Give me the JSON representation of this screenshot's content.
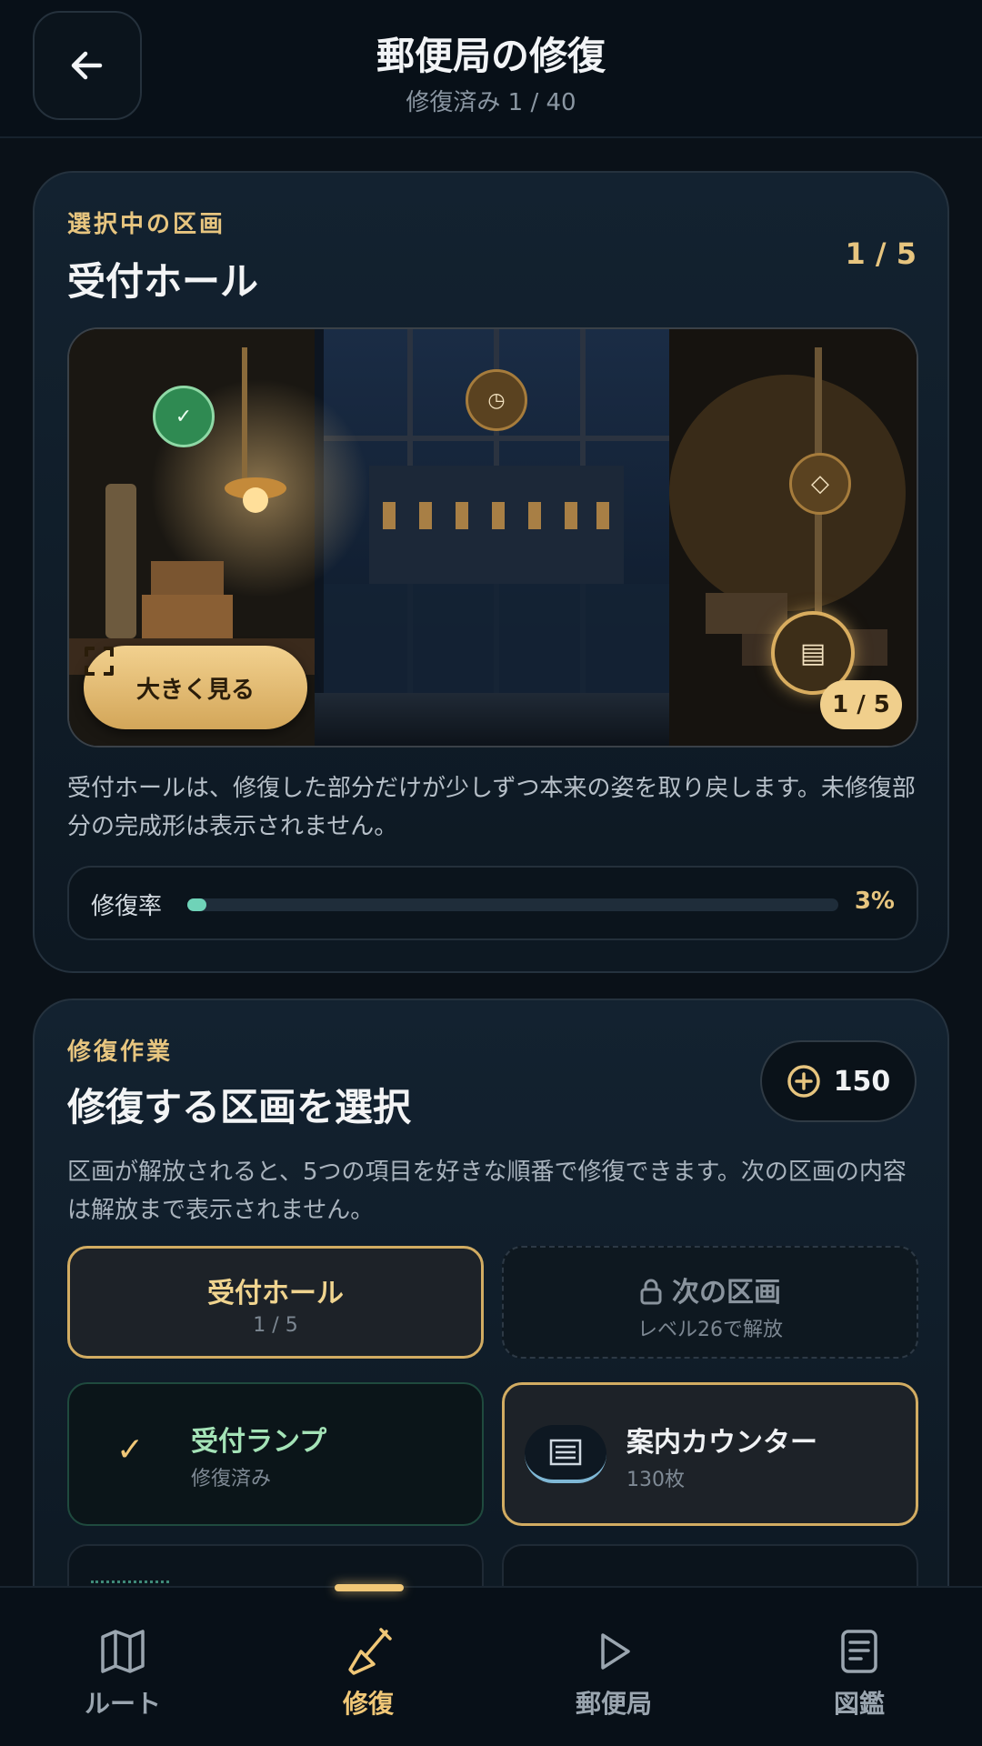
{
  "header": {
    "title": "郵便局の修復",
    "subtitle": "修復済み 1 / 40",
    "back_icon": "arrow-left-icon"
  },
  "selected_section": {
    "eyebrow": "選択中の区画",
    "title": "受付ホール",
    "counter": "1 / 5",
    "scene": {
      "hotspots": [
        {
          "icon": "check-icon",
          "glyph": "✓",
          "state": "restored"
        },
        {
          "icon": "clock-icon",
          "glyph": "◷",
          "state": "locked"
        },
        {
          "icon": "diamond-icon",
          "glyph": "◇",
          "state": "locked"
        },
        {
          "icon": "counter-icon",
          "glyph": "▤",
          "state": "selected"
        }
      ],
      "expand_label": "大きく見る",
      "badge": "1 / 5"
    },
    "description": "受付ホールは、修復した部分だけが少しずつ本来の姿を取り戻します。未修復部分の完成形は表示されません。",
    "progress": {
      "label": "修復率",
      "value_text": "3%",
      "value": 0.03
    }
  },
  "repair_work": {
    "eyebrow": "修復作業",
    "title": "修復する区画を選択",
    "coins": "150",
    "description": "区画が解放されると、5つの項目を好きな順番で修復できます。次の区画の内容は解放まで表示されません。",
    "sections": [
      {
        "title": "受付ホール",
        "sub": "1 / 5",
        "state": "selected"
      },
      {
        "title": "次の区画",
        "sub": "レベル26で解放",
        "state": "locked"
      }
    ],
    "items": [
      {
        "title": "受付ランプ",
        "sub": "修復済み",
        "state": "restored",
        "icon": "check-icon"
      },
      {
        "title": "案内カウンター",
        "sub": "130枚",
        "state": "selected",
        "icon": "counter-icon"
      }
    ]
  },
  "nav": {
    "items": [
      {
        "label": "ルート",
        "icon": "map-icon"
      },
      {
        "label": "修復",
        "icon": "trowel-icon",
        "active": true
      },
      {
        "label": "郵便局",
        "icon": "play-icon"
      },
      {
        "label": "図鑑",
        "icon": "document-icon"
      }
    ]
  },
  "colors": {
    "accent_gold": "#e7c57f",
    "restored_green": "#6fd3b8",
    "background": "#0a1118"
  }
}
